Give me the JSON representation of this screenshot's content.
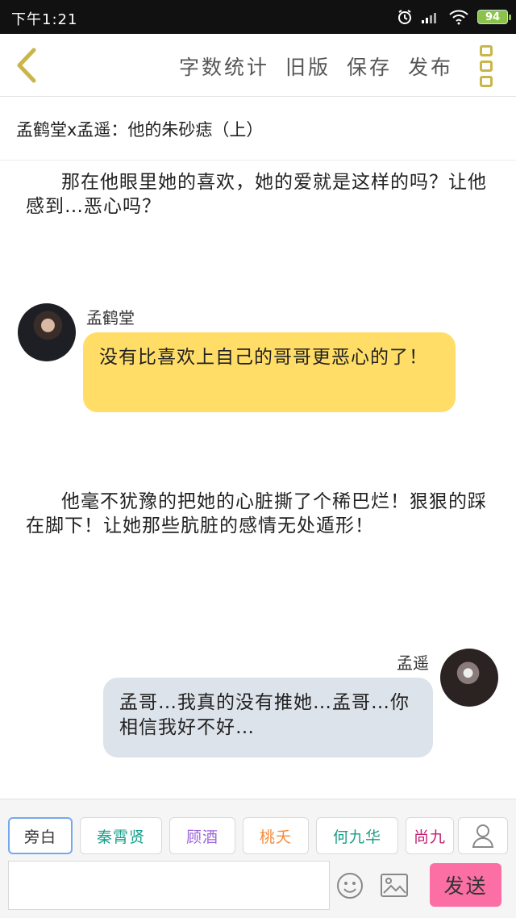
{
  "status_bar": {
    "time": "下午1:21",
    "battery": "94",
    "icons": [
      "alarm-icon",
      "signal-icon",
      "wifi-icon",
      "battery-icon"
    ]
  },
  "toolbar": {
    "actions": [
      "字数统计",
      "旧版",
      "保存",
      "发布"
    ],
    "icons": [
      "chevron-left-icon",
      "more-menu-icon"
    ],
    "accent_color": "#c9b64a"
  },
  "document": {
    "title": "孟鹤堂x孟遥：他的朱砂痣（上）"
  },
  "story": {
    "narration_1": "那在他眼里她的喜欢，她的爱就是这样的吗？让他感到…恶心吗？",
    "dialogue_1": {
      "speaker": "孟鹤堂",
      "text": "没有比喜欢上自己的哥哥更恶心的了！",
      "bubble_color": "#ffdd67"
    },
    "narration_2": "他毫不犹豫的把她的心脏撕了个稀巴烂！狠狠的踩在脚下！让她那些肮脏的感情无处遁形！",
    "dialogue_2": {
      "speaker": "孟遥",
      "text": "孟哥…我真的没有推她…孟哥…你相信我好不好…",
      "bubble_color": "#dde3ea"
    }
  },
  "composer": {
    "roles": [
      {
        "label": "旁白",
        "color": "#333333"
      },
      {
        "label": "秦霄贤",
        "color": "#18a08c"
      },
      {
        "label": "顾酒",
        "color": "#9b66d8"
      },
      {
        "label": "桃夭",
        "color": "#f58b3d"
      },
      {
        "label": "何九华",
        "color": "#1c9c86"
      },
      {
        "label": "尚九",
        "color": "#c21e73"
      }
    ],
    "input_placeholder": "",
    "send_label": "发送",
    "send_color": "#fb6fa5",
    "icons": [
      "profile-icon",
      "emoji-icon",
      "image-icon"
    ]
  }
}
